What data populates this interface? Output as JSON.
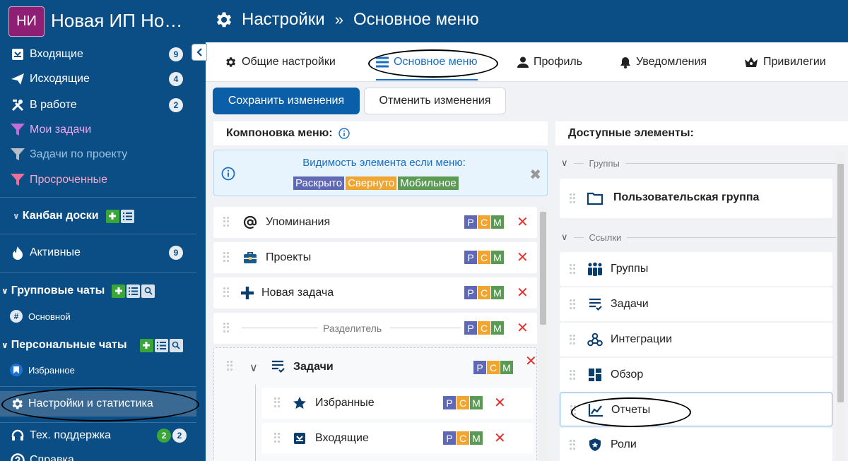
{
  "workspace": {
    "badge": "НИ",
    "name": "Новая ИП Но…"
  },
  "breadcrumb": {
    "section": "Настройки",
    "separator": "»",
    "page": "Основное меню"
  },
  "sidebar": {
    "items": [
      {
        "label": "Входящие",
        "count": "9"
      },
      {
        "label": "Исходящие",
        "count": "4"
      },
      {
        "label": "В работе",
        "count": "2"
      },
      {
        "label": "Мои задачи"
      },
      {
        "label": "Задачи по проекту"
      },
      {
        "label": "Просроченные"
      }
    ],
    "kanban": {
      "label": "Канбан доски",
      "item": "Активные",
      "count": "9"
    },
    "group_chats": {
      "label": "Групповые чаты",
      "channel": "Основной",
      "channel_tag": "#"
    },
    "personal_chats": {
      "label": "Персональные чаты",
      "favorite": "Избранное"
    },
    "settings": "Настройки и статистика",
    "support": {
      "label": "Тех. поддержка",
      "count_a": "2",
      "count_b": "2"
    },
    "help": "Справка"
  },
  "tabs": [
    {
      "label": "Общие настройки"
    },
    {
      "label": "Основное меню",
      "active": true
    },
    {
      "label": "Профиль"
    },
    {
      "label": "Уведомления"
    },
    {
      "label": "Привилегии"
    }
  ],
  "toolbar": {
    "save": "Сохранить изменения",
    "cancel": "Отменить изменения"
  },
  "layout_panel": {
    "title": "Компоновка меню:",
    "visibility": {
      "title": "Видимость элемента если меню:",
      "expanded": "Раскрыто",
      "collapsed": "Свернуто",
      "mobile": "Мобильное"
    },
    "flags": {
      "p": "Р",
      "c": "С",
      "m": "М",
      "delete": "✕"
    },
    "rows": [
      {
        "label": "Упоминания",
        "icon": "at-icon"
      },
      {
        "label": "Проекты",
        "icon": "briefcase-icon"
      },
      {
        "label": "Новая задача",
        "icon": "plus-icon"
      },
      {
        "label": "Разделитель",
        "icon": "separator"
      }
    ],
    "group": {
      "label": "Задачи",
      "children": [
        {
          "label": "Избранные",
          "icon": "star-icon"
        },
        {
          "label": "Входящие",
          "icon": "inbox-icon"
        }
      ]
    }
  },
  "available_panel": {
    "title": "Доступные элементы:",
    "groups_header": "Группы",
    "custom_group": "Пользовательская группа",
    "links_header": "Ссылки",
    "links": [
      {
        "label": "Группы",
        "icon": "people-icon"
      },
      {
        "label": "Задачи",
        "icon": "tasks-icon"
      },
      {
        "label": "Интеграции",
        "icon": "webhook-icon"
      },
      {
        "label": "Обзор",
        "icon": "dashboard-icon"
      },
      {
        "label": "Отчеты",
        "icon": "chart-icon"
      },
      {
        "label": "Роли",
        "icon": "shield-icon"
      }
    ]
  },
  "colors": {
    "header_bg": "#0b4d85",
    "accent": "#1a6fc4",
    "primary_btn": "#0b5ea8",
    "workspace_badge": "#8f1f74",
    "delete": "#e0322f"
  }
}
